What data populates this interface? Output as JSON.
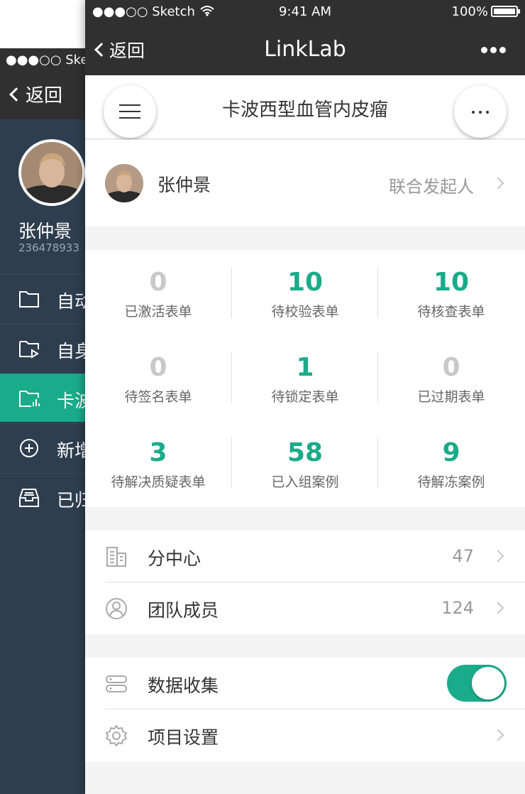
{
  "background_screen": {
    "status_text": "●●●○○ Sketch",
    "back_label": "返回",
    "user_name": "张仲景",
    "user_id": "236478933",
    "menu_items": [
      {
        "label": "自动",
        "icon": "folder-icon",
        "active": false
      },
      {
        "label": "自身",
        "icon": "folder-play-icon",
        "active": false
      },
      {
        "label": "卡波",
        "icon": "folder-chart-icon",
        "active": true
      },
      {
        "label": "新增",
        "icon": "plus-circle-icon",
        "active": false
      },
      {
        "label": "已归",
        "icon": "archive-icon",
        "active": false
      }
    ]
  },
  "status_bar": {
    "signal": "●●●○○ Sketch",
    "time": "9:41 AM",
    "battery": "100%"
  },
  "nav_bar": {
    "back_label": "返回",
    "title": "LinkLab"
  },
  "project": {
    "title": "卡波西型血管内皮瘤"
  },
  "owner": {
    "name": "张仲景",
    "role": "联合发起人"
  },
  "stats": [
    {
      "value": "0",
      "label": "已激活表单",
      "highlight": false
    },
    {
      "value": "10",
      "label": "待校验表单",
      "highlight": true
    },
    {
      "value": "10",
      "label": "待核查表单",
      "highlight": true
    },
    {
      "value": "0",
      "label": "待签名表单",
      "highlight": false
    },
    {
      "value": "1",
      "label": "待锁定表单",
      "highlight": true
    },
    {
      "value": "0",
      "label": "已过期表单",
      "highlight": false
    },
    {
      "value": "3",
      "label": "待解决质疑表单",
      "highlight": true
    },
    {
      "value": "58",
      "label": "已入组案例",
      "highlight": true
    },
    {
      "value": "9",
      "label": "待解冻案例",
      "highlight": true
    }
  ],
  "list_group1": [
    {
      "label": "分中心",
      "count": "47",
      "icon": "building-icon"
    },
    {
      "label": "团队成员",
      "count": "124",
      "icon": "user-circle-icon"
    }
  ],
  "list_group2": [
    {
      "label": "数据收集",
      "icon": "database-icon",
      "toggle_on": true
    },
    {
      "label": "项目设置",
      "icon": "gear-icon"
    }
  ],
  "colors": {
    "accent": "#1aab8a",
    "nav_bg": "#303030",
    "sidebar_bg": "#2e3e4f",
    "zero_value": "#c9c9c9"
  }
}
